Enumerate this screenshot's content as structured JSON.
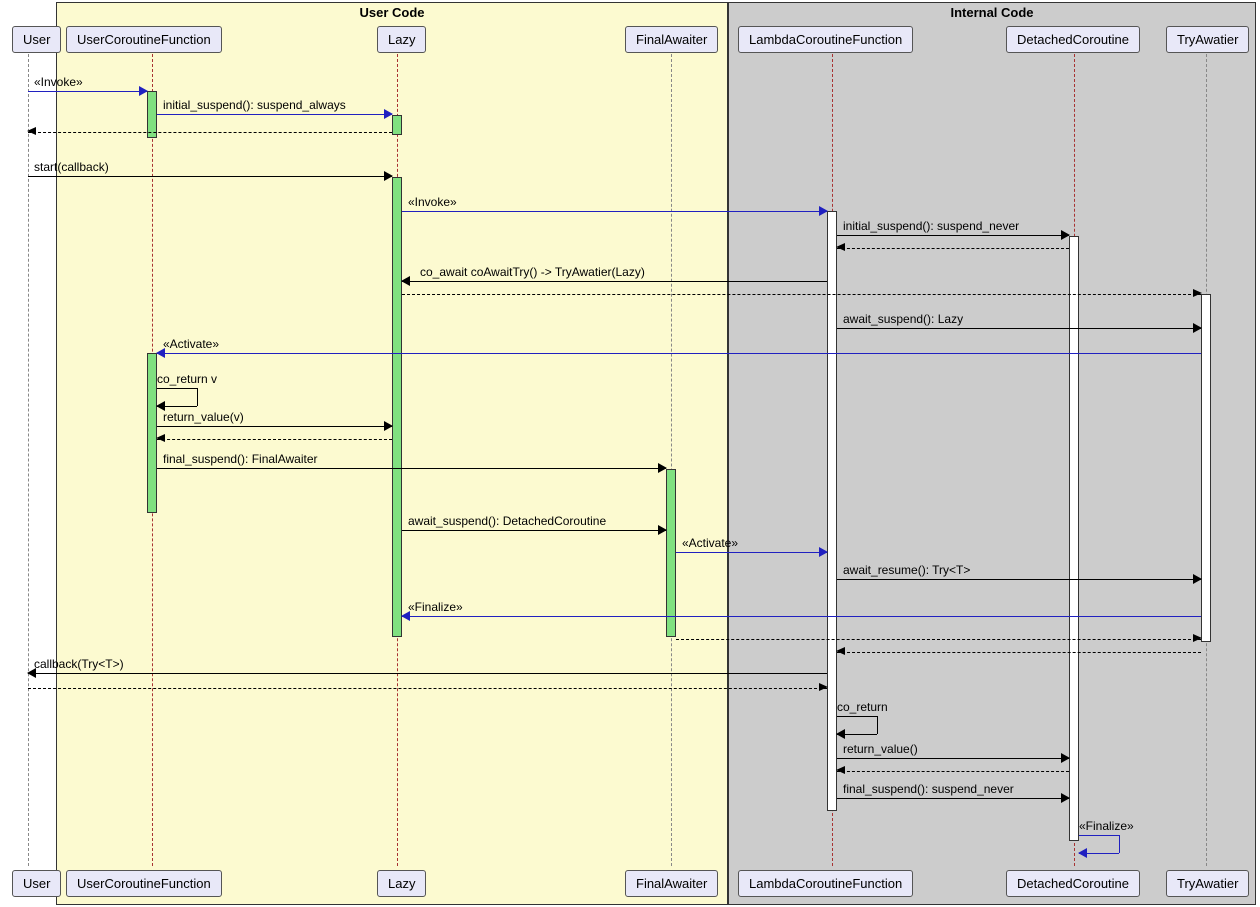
{
  "parts": {
    "user_code": "User Code",
    "internal_code": "Internal Code"
  },
  "participants": {
    "user": "User",
    "ucf": "UserCoroutineFunction",
    "lazy": "Lazy",
    "fa": "FinalAwaiter",
    "lcf": "LambdaCoroutineFunction",
    "dc": "DetachedCoroutine",
    "ta": "TryAwatier"
  },
  "messages": {
    "m1": "«Invoke»",
    "m2": "initial_suspend(): suspend_always",
    "m3": "start(callback)",
    "m4": "«Invoke»",
    "m5": "initial_suspend(): suspend_never",
    "m6": "co_await coAwaitTry() -> TryAwatier(Lazy)",
    "m7": "await_suspend(): Lazy",
    "m8": "«Activate»",
    "m9": "co_return v",
    "m10": "return_value(v)",
    "m11": "final_suspend(): FinalAwaiter",
    "m12": "await_suspend(): DetachedCoroutine",
    "m13": "«Activate»",
    "m14": "await_resume(): Try<T>",
    "m15": "«Finalize»",
    "m16": "callback(Try<T>)",
    "m17": "co_return",
    "m18": "return_value()",
    "m19": "final_suspend(): suspend_never",
    "m20": "«Finalize»"
  }
}
